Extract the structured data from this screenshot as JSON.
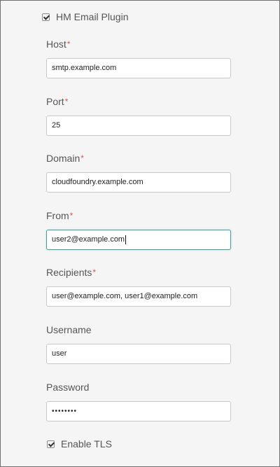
{
  "plugin": {
    "label": "HM Email Plugin",
    "checked": true
  },
  "fields": {
    "host": {
      "label": "Host",
      "required_mark": "*",
      "value": "smtp.example.com"
    },
    "port": {
      "label": "Port",
      "required_mark": "*",
      "value": "25"
    },
    "domain": {
      "label": "Domain",
      "required_mark": "*",
      "value": "cloudfoundry.example.com"
    },
    "from": {
      "label": "From",
      "required_mark": "*",
      "value": "user2@example.com"
    },
    "recipients": {
      "label": "Recipients",
      "required_mark": "*",
      "value": "user@example.com, user1@example.com"
    },
    "username": {
      "label": "Username",
      "value": "user"
    },
    "password": {
      "label": "Password",
      "value": "••••••••"
    }
  },
  "tls": {
    "label": "Enable TLS",
    "checked": true
  },
  "colors": {
    "required": "#d9534f",
    "focus_border": "#3fa0a0"
  }
}
